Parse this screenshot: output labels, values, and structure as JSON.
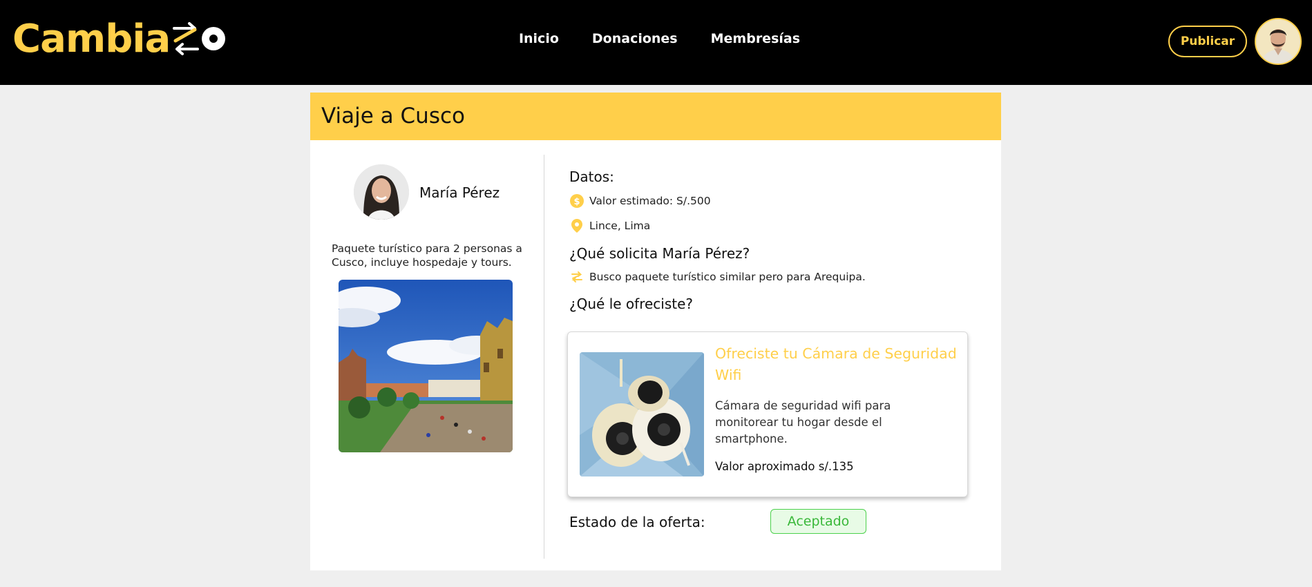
{
  "header": {
    "logo_text": "Cambia",
    "logo_suffix": "o",
    "nav": [
      "Inicio",
      "Donaciones",
      "Membresías"
    ],
    "publish_label": "Publicar"
  },
  "post": {
    "title": "Viaje a Cusco",
    "owner_name": "María Pérez",
    "description": "Paquete turístico para 2 personas a Cusco, incluye hospedaje y tours."
  },
  "details": {
    "heading": "Datos:",
    "estimated_value": "Valor estimado: S/.500",
    "location": "Lince, Lima",
    "request_heading": "¿Qué solicita María Pérez?",
    "request_text": "Busco paquete turístico similar pero para Arequipa.",
    "offer_heading": "¿Qué le ofreciste?"
  },
  "offer": {
    "title": "Ofreciste tu Cámara de Seguridad Wifi",
    "description": "Cámara de seguridad wifi para monitorear tu hogar desde el smartphone.",
    "value": "Valor aproximado s/.135"
  },
  "status": {
    "label": "Estado de la oferta:",
    "value": "Aceptado"
  },
  "icons": {
    "value": "coin-icon",
    "location": "location-pin-icon",
    "request": "exchange-icon",
    "logo": "swap-arrows-icon"
  },
  "colors": {
    "accent": "#ffcf4a",
    "header_bg": "#000000",
    "success": "#3ab83a"
  }
}
